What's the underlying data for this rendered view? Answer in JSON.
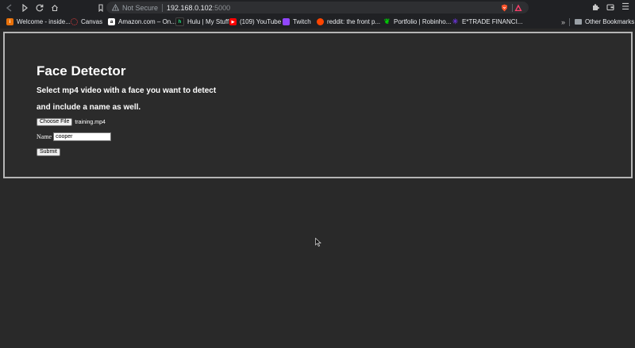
{
  "browser": {
    "omnibox": {
      "security_label": "Not Secure",
      "host": "192.168.0.102",
      "port": ":5000"
    },
    "bookmarks": [
      {
        "label": "Welcome - inside...",
        "icon": "inside-icon",
        "color": "#e8710a"
      },
      {
        "label": "Canvas",
        "icon": "canvas-icon",
        "color": "#e13c3c"
      },
      {
        "label": "Amazon.com – On...",
        "icon": "amazon-icon",
        "color": "#ffffff"
      },
      {
        "label": "Hulu | My Stuff",
        "icon": "hulu-icon",
        "color": "#1ce783"
      },
      {
        "label": "(109) YouTube",
        "icon": "youtube-icon",
        "color": "#ff0000"
      },
      {
        "label": "Twitch",
        "icon": "twitch-icon",
        "color": "#9146ff"
      },
      {
        "label": "reddit: the front p...",
        "icon": "reddit-icon",
        "color": "#ff4500"
      },
      {
        "label": "Portfolio | Robinho...",
        "icon": "robinhood-icon",
        "color": "#00c805"
      },
      {
        "label": "E*TRADE FINANCI...",
        "icon": "etrade-icon",
        "color": "#6633cc"
      }
    ],
    "overflow_label": "»",
    "other_bookmarks_label": "Other Bookmarks"
  },
  "page": {
    "title": "Face Detector",
    "subtitle_line1": "Select mp4 video with a face you want to detect",
    "subtitle_line2": "and include a name as well.",
    "file_button_label": "Choose File",
    "file_name": "training.mp4",
    "name_label": "Name",
    "name_value": "cooper",
    "submit_label": "Submit"
  },
  "colors": {
    "page_background": "#292929",
    "panel_border": "#b5b5b5",
    "text": "#ffffff"
  }
}
